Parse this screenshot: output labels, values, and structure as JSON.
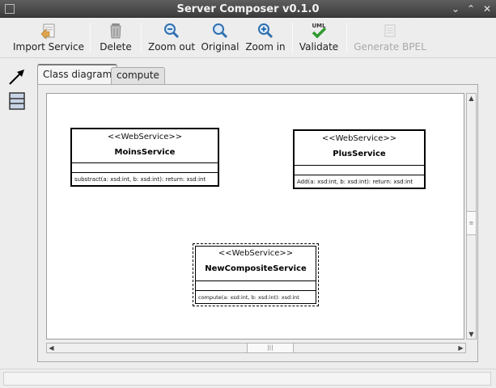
{
  "window": {
    "title": "Server Composer v0.1.0",
    "minimize_glyph": "⌄",
    "maximize_glyph": "⌃",
    "close_glyph": "✕"
  },
  "toolbar": {
    "import_label": "Import Service",
    "delete_label": "Delete",
    "zoom_out_label": "Zoom out",
    "original_label": "Original",
    "zoom_in_label": "Zoom in",
    "validate_label": "Validate",
    "generate_label": "Generate BPEL",
    "validate_icon_text": "UML",
    "generate_enabled": false
  },
  "tabs": [
    {
      "label": "Class diagram",
      "active": true
    },
    {
      "label": "compute",
      "active": false
    }
  ],
  "diagram": {
    "classes": [
      {
        "stereotype": "<<WebService>>",
        "name": "MoinsService",
        "operation": "substract(a: xsd:int, b: xsd:int): return: xsd:int",
        "selected": false
      },
      {
        "stereotype": "<<WebService>>",
        "name": "PlusService",
        "operation": "Add(a: xsd:int, b: xsd:int): return: xsd:int",
        "selected": false
      },
      {
        "stereotype": "<<WebService>>",
        "name": "NewCompositeService",
        "operation": "compute(a: xsd:int, b: xsd:int): xsd:int",
        "selected": true
      }
    ]
  },
  "scrollbars": {
    "up_glyph": "▲",
    "down_glyph": "▼",
    "left_glyph": "◀",
    "right_glyph": "▶",
    "v_grip": "≡",
    "h_grip": "|||"
  },
  "colors": {
    "titlebar": "#4a4a4a",
    "canvas": "#ffffff",
    "validate_check": "#2e9a2e",
    "zoom_icon": "#2f6fb0"
  }
}
